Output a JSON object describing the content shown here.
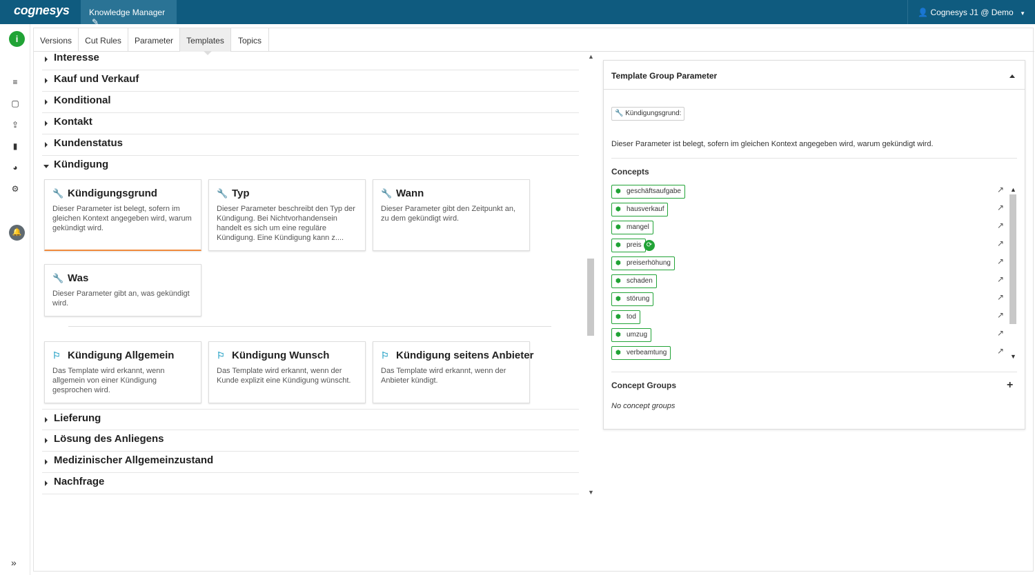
{
  "header": {
    "logo": "cognesys",
    "app_name": "Knowledge Manager",
    "user": "Cognesys J1 @ Demo"
  },
  "tabs": [
    "Versions",
    "Cut Rules",
    "Parameter",
    "Templates",
    "Topics"
  ],
  "active_tab": "Templates",
  "groups": {
    "interesse": "Interesse",
    "kauf": "Kauf und Verkauf",
    "konditional": "Konditional",
    "kontakt": "Kontakt",
    "kundenstatus": "Kundenstatus",
    "kuendigung": "Kündigung",
    "lieferung": "Lieferung",
    "loesung": "Lösung des Anliegens",
    "medizin": "Medizinischer Allgemeinzustand",
    "nachfrage": "Nachfrage"
  },
  "parameters": [
    {
      "title": "Kündigungsgrund",
      "desc": "Dieser Parameter ist belegt, sofern im gleichen Kontext angegeben wird, warum gekündigt wird."
    },
    {
      "title": "Typ",
      "desc": "Dieser Parameter beschreibt den Typ der Kündigung. Bei Nichtvorhandensein handelt es sich um eine reguläre Kündigung. Eine Kündigung kann z...."
    },
    {
      "title": "Wann",
      "desc": "Dieser Parameter gibt den Zeitpunkt an, zu dem gekündigt wird."
    },
    {
      "title": "Was",
      "desc": "Dieser Parameter gibt an, was gekündigt wird."
    }
  ],
  "templates": [
    {
      "title": "Kündigung Allgemein",
      "desc": "Das Template wird erkannt, wenn allgemein von einer Kündigung gesprochen wird."
    },
    {
      "title": "Kündigung Wunsch",
      "desc": "Das Template wird erkannt, wenn der Kunde explizit eine Kündigung wünscht."
    },
    {
      "title": "Kündigung seitens Anbieter",
      "desc": "Das Template wird erkannt, wenn der Anbieter kündigt."
    }
  ],
  "panel": {
    "title": "Template Group Parameter",
    "param_tag": "Kündigungsgrund:",
    "description": "Dieser Parameter ist belegt, sofern im gleichen Kontext angegeben wird, warum gekündigt wird.",
    "concepts_heading": "Concepts",
    "concepts": [
      "geschäftsaufgabe",
      "hausverkauf",
      "mangel",
      "preis",
      "preiserhöhung",
      "schaden",
      "störung",
      "tod",
      "umzug",
      "verbeamtung"
    ],
    "concept_groups_heading": "Concept Groups",
    "no_concept_groups": "No concept groups"
  },
  "icons": {
    "param": "wrench-icon",
    "template": "flag-icon",
    "concept": "cube-icon",
    "external": "external-link-icon"
  },
  "colors": {
    "topbar": "#0f5b7f",
    "accent_green": "#21a336",
    "accent_orange": "#f08a3b",
    "template_flag": "#2aa3c7"
  }
}
